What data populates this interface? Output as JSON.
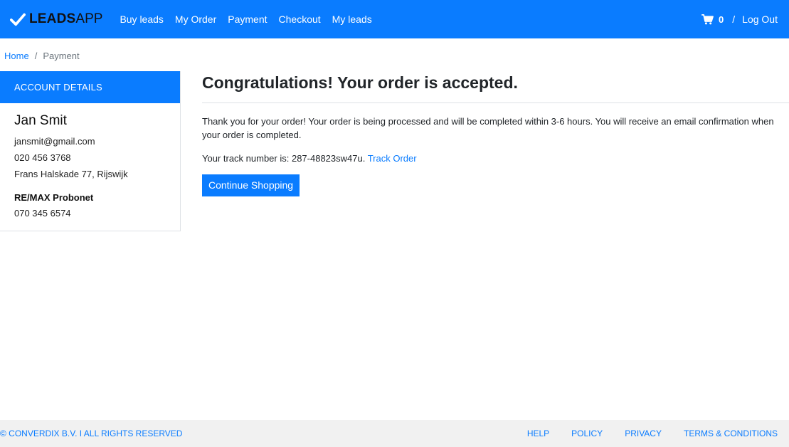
{
  "brand": {
    "bold": "LEADS",
    "light": "APP"
  },
  "nav": {
    "links": [
      "Buy leads",
      "My Order",
      "Payment",
      "Checkout",
      "My leads"
    ],
    "cart_count": "0",
    "separator": "/",
    "logout": "Log Out"
  },
  "breadcrumb": {
    "home": "Home",
    "divider": "/",
    "current": "Payment"
  },
  "sidebar": {
    "title": "ACCOUNT DETAILS",
    "name": "Jan Smit",
    "email": "jansmit@gmail.com",
    "phone": "020 456 3768",
    "address": "Frans Halskade 77, Rijswijk",
    "company": "RE/MAX Probonet",
    "company_phone": "070 345 6574"
  },
  "main": {
    "heading": "Congratulations! Your order is accepted.",
    "message": "Thank you for your order! Your order is being processed and will be completed within 3-6 hours. You will receive an email confirmation when your order is completed.",
    "track_prefix": "Your track number is: 287-48823sw47u.",
    "track_link": "Track Order",
    "continue_button": "Continue Shopping"
  },
  "footer": {
    "copyright": "© CONVERDIX B.V. I ALL RIGHTS RESERVED",
    "links": [
      "HELP",
      "POLICY",
      "PRIVACY",
      "TERMS & CONDITIONS"
    ]
  },
  "colors": {
    "primary": "#0a7cff",
    "footer_bg": "#f1f1f1",
    "text": "#212529"
  }
}
